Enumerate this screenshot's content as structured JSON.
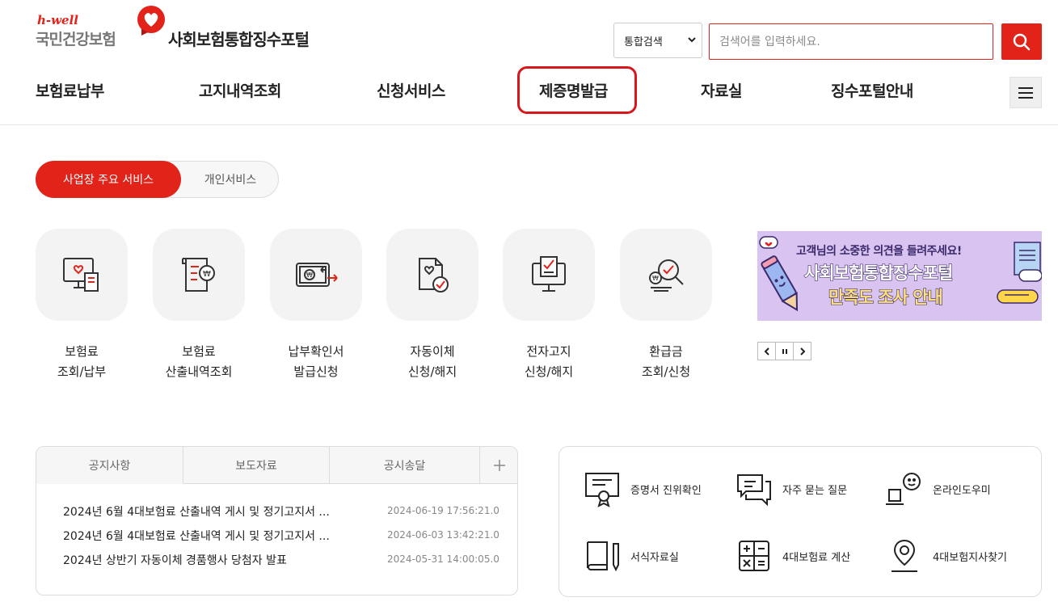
{
  "header": {
    "logo_brand": "h-well",
    "logo_name": "국민건강보험",
    "portal_title": "사회보험통합징수포털",
    "search_scope": "통합검색",
    "search_placeholder": "검색어를 입력하세요."
  },
  "nav": {
    "items": [
      "보험료납부",
      "고지내역조회",
      "신청서비스",
      "제증명발급",
      "자료실",
      "징수포털안내"
    ],
    "highlighted": "제증명발급"
  },
  "service_tabs": {
    "active": "사업장 주요 서비스",
    "inactive": "개인서비스"
  },
  "services": [
    {
      "label": "보험료\n조회/납부",
      "icon": "monitor-receipt-icon"
    },
    {
      "label": "보험료\n산출내역조회",
      "icon": "document-won-icon"
    },
    {
      "label": "납부확인서\n발급신청",
      "icon": "card-won-icon"
    },
    {
      "label": "자동이체\n신청/해지",
      "icon": "document-check-icon"
    },
    {
      "label": "전자고지\n신청/해지",
      "icon": "monitor-check-icon"
    },
    {
      "label": "환급금\n조회/신청",
      "icon": "magnifier-won-icon"
    }
  ],
  "banner": {
    "line1": "고객님의 소중한 의견을 들려주세요!",
    "line2": "사회보험통합징수포털",
    "line3": "만족도 조사 안내"
  },
  "notice": {
    "tabs": [
      "공지사항",
      "보도자료",
      "공시송달"
    ],
    "rows": [
      {
        "title": "2024년 6월 4대보험료 산출내역 게시 및 정기고지서 ...",
        "date": "2024-06-19 17:56:21.0"
      },
      {
        "title": "2024년 6월 4대보험료 산출내역 게시 및 정기고지서 ...",
        "date": "2024-06-03 13:42:21.0"
      },
      {
        "title": "2024년 상반기 자동이체 경품행사 당첨자 발표",
        "date": "2024-05-31 14:00:05.0"
      }
    ]
  },
  "quick_links": [
    {
      "label": "증명서 진위확인",
      "icon": "certificate-icon"
    },
    {
      "label": "자주 묻는 질문",
      "icon": "chat-bubbles-icon"
    },
    {
      "label": "온라인도우미",
      "icon": "online-helper-icon"
    },
    {
      "label": "서식자료실",
      "icon": "book-pen-icon"
    },
    {
      "label": "4대보험료 계산",
      "icon": "calculator-icon"
    },
    {
      "label": "4대보험지사찾기",
      "icon": "location-pin-icon"
    }
  ],
  "colors": {
    "accent": "#e2231a",
    "highlight_border": "#d8161d"
  }
}
